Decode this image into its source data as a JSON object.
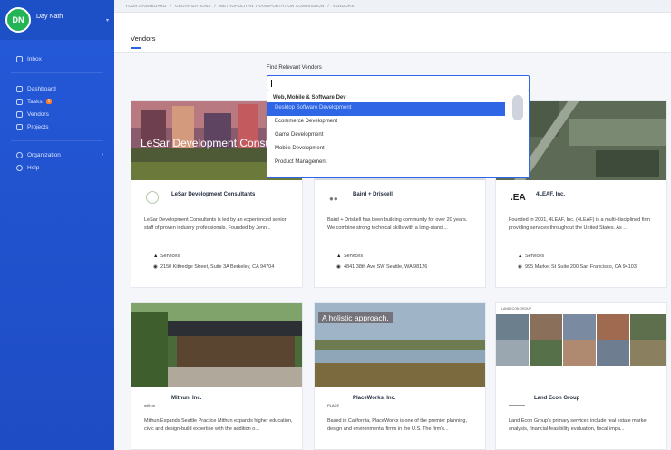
{
  "user": {
    "initials": "DN",
    "name": "Day Nath",
    "subtitle": "---"
  },
  "sidebar": {
    "items": [
      {
        "label": "Inbox"
      },
      {
        "label": "Dashboard"
      },
      {
        "label": "Tasks",
        "badge": "1"
      },
      {
        "label": "Vendors"
      },
      {
        "label": "Projects"
      },
      {
        "label": "Organization"
      },
      {
        "label": "Help"
      }
    ]
  },
  "breadcrumb": [
    "YOUR DASHBOARD",
    "ORGANIZATIONS",
    "METROPOLITAN TRANSPORTATION COMMISSION",
    "VENDORS"
  ],
  "page": {
    "title": "Vendors"
  },
  "search": {
    "label": "Find Relevant Vendors",
    "value": "",
    "group": "Web, Mobile & Software Dev",
    "options": [
      "Desktop Software Development",
      "Ecommerce Development",
      "Game Development",
      "Mobile Development",
      "Product Management"
    ]
  },
  "vendors": [
    {
      "name": "LeSar Development Consultants",
      "image_caption": "LeSar Development Consu",
      "desc": "LeSar Development Consultants is led by an experienced senior staff of proven industry professionals. Founded by Jenn...",
      "services_label": "Services",
      "address": "2150 Kittredge Street, Suite 3A Berkeley, CA 94704"
    },
    {
      "name": "Baird + Driskell",
      "image_caption": "",
      "desc": "Baird + Driskell has been building community for over 20 years. We combine strong technical skills with a long-standi...",
      "services_label": "Services",
      "address": "4841 38th Ave SW Seattle, WA 98126"
    },
    {
      "name": "4LEAF, Inc.",
      "logo_text": ".EA",
      "desc": "Founded in 2001, 4LEAF, Inc. (4LEAF) is a multi-disciplined firm providing services throughout the United States. As ...",
      "services_label": "Services",
      "address": "995 Market St Suite 200 San Francisco, CA 94103"
    },
    {
      "name": "Mithun, Inc.",
      "logo_text": "mithun",
      "desc": "Mithun Expands Seattle Practice Mithun expands higher education, civic and design-build expertise with the addition o..."
    },
    {
      "name": "PlaceWorks, Inc.",
      "logo_text": "PLACE",
      "image_caption": "A holistic approach.",
      "desc": "Based in California, PlaceWorks is one of the premier planning, design and environmental firms in the U.S. The firm's..."
    },
    {
      "name": "Land Econ Group",
      "image_caption": "LANDECON GROUP",
      "desc": "Land Econ Group's primary services include real estate market analysis, financial feasibility evaluation, fiscal impa..."
    }
  ]
}
